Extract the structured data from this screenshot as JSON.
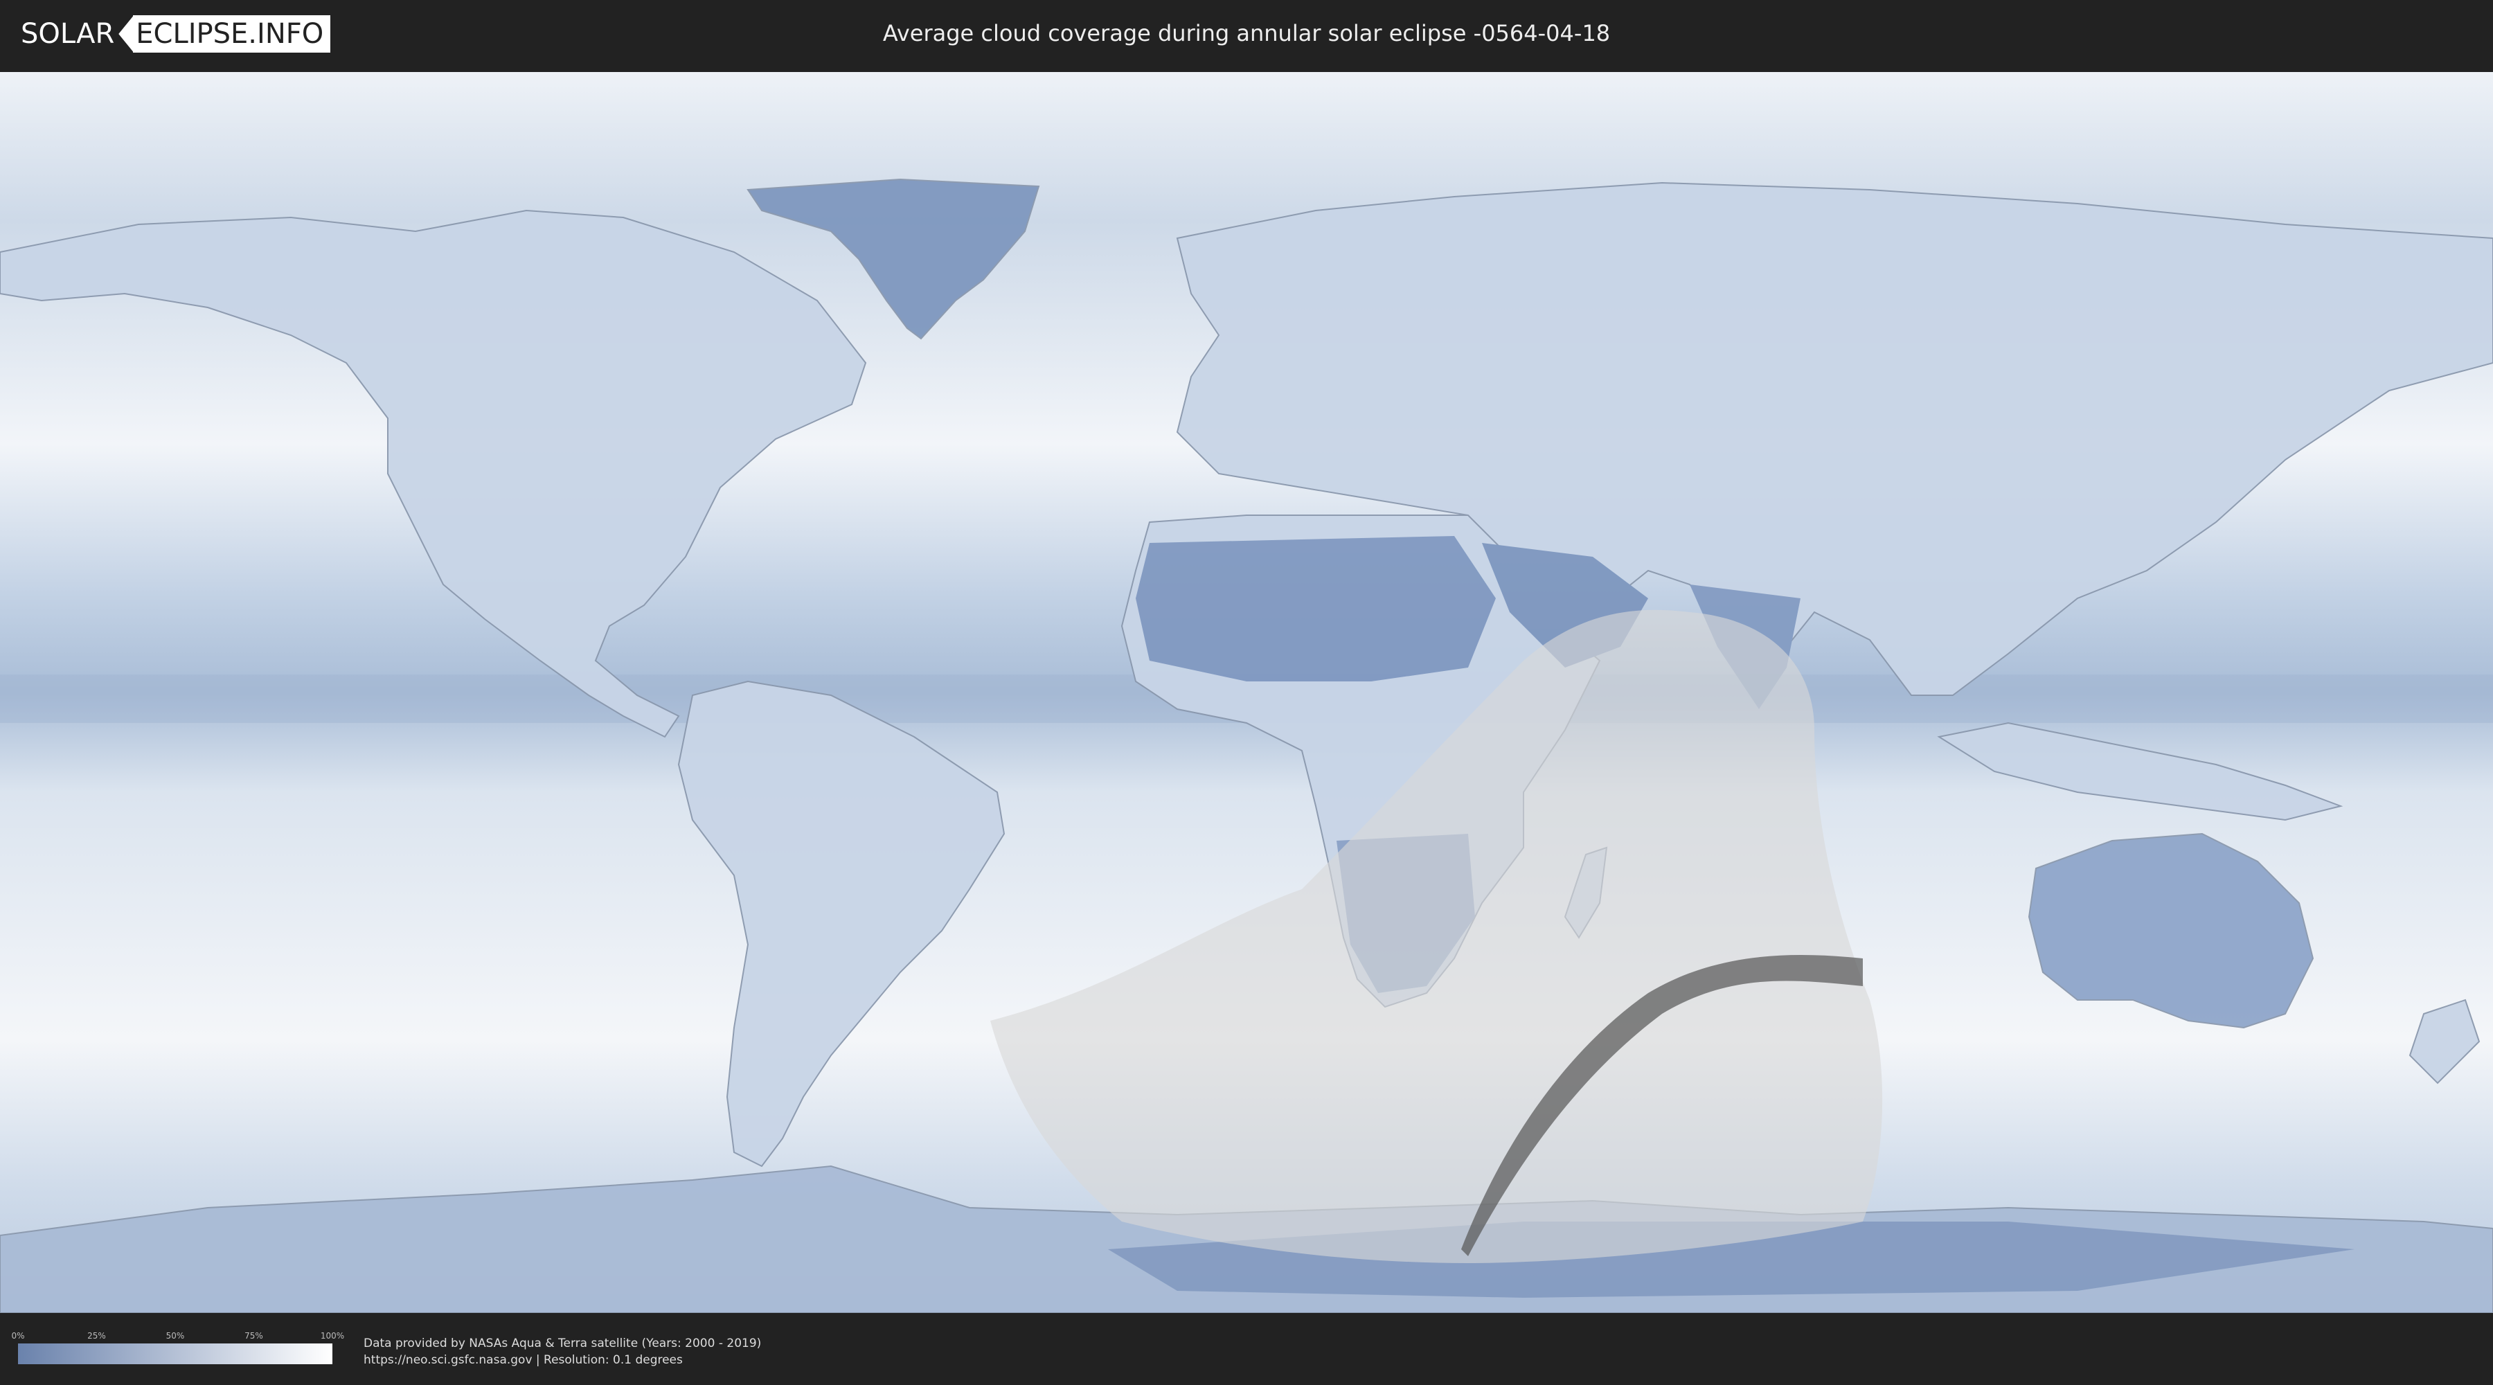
{
  "header": {
    "logo_solar": "SOLAR",
    "logo_eclipse": "ECLIPSE.INFO",
    "title": "Average cloud coverage during annular solar eclipse -0564-04-18"
  },
  "map": {
    "layer": "cloud-coverage",
    "eclipse_type": "annular",
    "date": "-0564-04-18",
    "colors": {
      "low_cloud": "#6a82ac",
      "high_cloud": "#ffffff",
      "eclipse_region": "#d8d8d8",
      "central_path": "#555555"
    }
  },
  "legend": {
    "ticks": [
      "0%",
      "25%",
      "50%",
      "75%",
      "100%"
    ]
  },
  "footer": {
    "credit_line1": "Data provided by NASAs Aqua & Terra satellite (Years: 2000 - 2019)",
    "credit_line2": "https://neo.sci.gsfc.nasa.gov | Resolution: 0.1 degrees"
  }
}
